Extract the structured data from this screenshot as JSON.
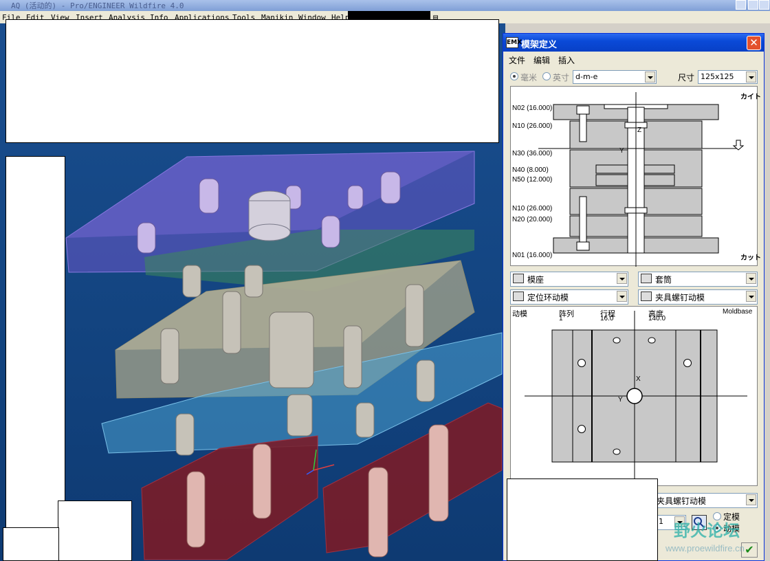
{
  "window": {
    "title": "AQ (活动的) - Pro/ENGINEER Wildfire 4.0"
  },
  "menu": [
    "File",
    "Edit",
    "View",
    "Insert",
    "Analysis",
    "Info",
    "Applications",
    "Tools",
    "Manikin",
    "Window",
    "Help"
  ],
  "menu_tail": "具",
  "dialog": {
    "title": "模架定义",
    "icon_text": "EMX",
    "menu": [
      "文件",
      "编辑",
      "插入"
    ],
    "unit_mm": "毫米",
    "unit_inch": "英寸",
    "plate_type": "d-m-e",
    "size_label": "尺寸",
    "size_value": "125x125",
    "section_labels": [
      "N02 (16.000)",
      "N10 (26.000)",
      "N30 (36.000)",
      "N40 (8.000)",
      "N50 (12.000)",
      "N10 (26.000)",
      "N20 (20.000)",
      "N01 (16.000)"
    ],
    "cut_top": "カイト",
    "cut_bottom": "カット",
    "section_axis_z": "Z",
    "section_axis_y": "Y",
    "combo_mold_base": "模座",
    "combo_sleeve": "套筒",
    "combo_locate": "定位环动模",
    "combo_clamp": "夹具螺钉动模",
    "plan_label_moving": "动模",
    "plan_label_array": "阵列",
    "plan_value_array": "1",
    "plan_label_stroke": "行程",
    "plan_value_stroke": "16.0",
    "plan_label_height": "高度",
    "plan_value_height": "140.0",
    "plan_label_moldbase": "Moldbase",
    "plan_axis_x": "X",
    "plan_axis_y": "Y",
    "bottom_combo": "夹具螺钉动模",
    "bottom_spin_value": "1",
    "radio_fixed": "定模",
    "radio_moving": "动模"
  },
  "watermark": {
    "logo": "野火论坛",
    "url": "www.proewildfire.cn"
  }
}
